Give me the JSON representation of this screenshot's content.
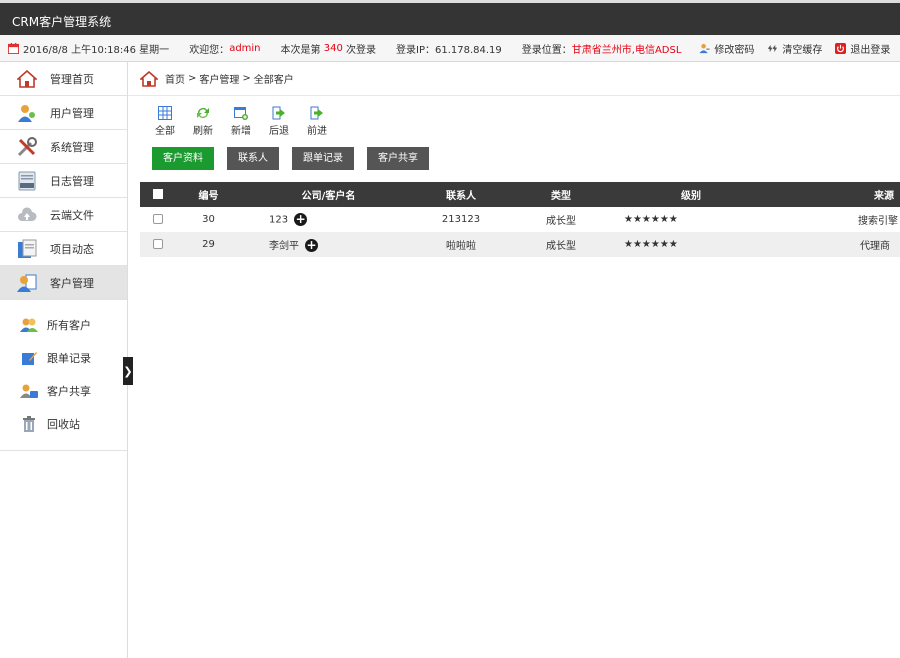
{
  "app": {
    "title": "CRM客户管理系统"
  },
  "status": {
    "datetime": "2016/8/8 上午10:18:46 星期一",
    "welcome_prefix": "欢迎您：",
    "username": "admin",
    "login_count_prefix": "本次是第",
    "login_count": "340",
    "login_count_suffix": "次登录",
    "ip_label": "登录IP：61.178.84.19",
    "location_prefix": "登录位置：",
    "location": "甘肃省兰州市,电信ADSL",
    "change_password": "修改密码",
    "clear_cache": "清空缓存",
    "logout": "退出登录"
  },
  "sidebar": {
    "items": [
      {
        "label": "管理首页",
        "icon": "home-icon"
      },
      {
        "label": "用户管理",
        "icon": "users-icon"
      },
      {
        "label": "系统管理",
        "icon": "tools-icon"
      },
      {
        "label": "日志管理",
        "icon": "log-icon"
      },
      {
        "label": "云端文件",
        "icon": "cloud-icon"
      },
      {
        "label": "项目动态",
        "icon": "project-icon"
      },
      {
        "label": "客户管理",
        "icon": "customer-icon"
      }
    ],
    "sub_items": [
      {
        "label": "所有客户",
        "icon": "all-customers-icon"
      },
      {
        "label": "跟单记录",
        "icon": "edit-icon"
      },
      {
        "label": "客户共享",
        "icon": "share-icon"
      },
      {
        "label": "回收站",
        "icon": "trash-icon"
      }
    ],
    "collapse_glyph": "❯"
  },
  "breadcrumb": {
    "home": "首页",
    "sep1": ">",
    "module": "客户管理",
    "sep2": ">",
    "page": "全部客户"
  },
  "toolbar": {
    "all": "全部",
    "refresh": "刷新",
    "add": "新增",
    "back": "后退",
    "forward": "前进"
  },
  "tabs": [
    "客户资料",
    "联系人",
    "跟单记录",
    "客户共享"
  ],
  "table": {
    "headers": [
      "编号",
      "公司/客户名",
      "联系人",
      "类型",
      "级别",
      "来源"
    ],
    "rows": [
      {
        "id": "30",
        "name": "123",
        "contact": "213123",
        "type": "成长型",
        "level": "★★★★★★",
        "source": "搜索引擎"
      },
      {
        "id": "29",
        "name": "李剑平",
        "contact": "啦啦啦",
        "type": "成长型",
        "level": "★★★★★★",
        "source": "代理商"
      }
    ]
  },
  "colors": {
    "topbar": "#343434",
    "accent_green": "#1b9a2f",
    "highlight_red": "#e60012"
  }
}
